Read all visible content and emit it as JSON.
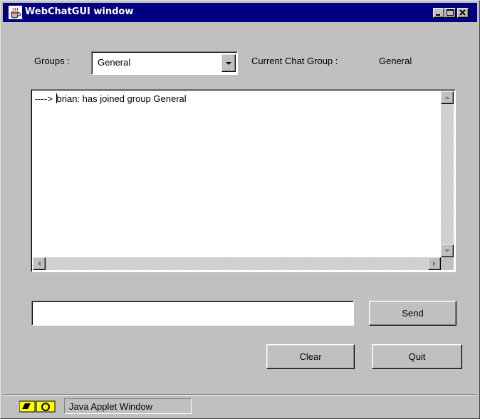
{
  "window": {
    "title": "WebChatGUI window",
    "icon": "java-coffee-cup-icon"
  },
  "groups": {
    "label": "Groups :",
    "selected": "General"
  },
  "current_group": {
    "label": "Current Chat Group :",
    "value": "General"
  },
  "chat": {
    "lines": [
      "----> brian: has joined group General"
    ]
  },
  "message_input": {
    "value": ""
  },
  "buttons": {
    "send": "Send",
    "clear": "Clear",
    "quit": "Quit"
  },
  "status": {
    "text": "Java Applet Window",
    "icon": "java-applet-warning-icon"
  },
  "colors": {
    "titlebar": "#000080",
    "face": "#c0c0c0"
  }
}
